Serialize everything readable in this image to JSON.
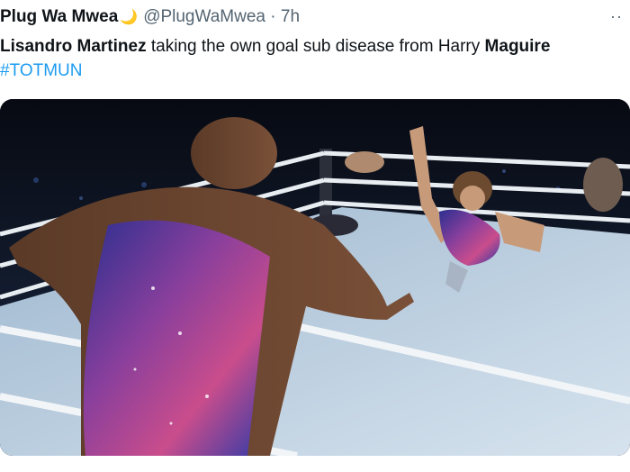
{
  "tweet": {
    "display_name": "Plug Wa Mwea",
    "name_emoji": "crescent-moon-icon",
    "handle": "@PlugWaMwea",
    "separator": "·",
    "time": "7h",
    "more_label": "··",
    "text": {
      "part1_bold": "Lisandro Martinez",
      "part2": " taking the own goal sub disease from Harry ",
      "part3_bold": "Maguire",
      "hashtag": "#TOTMUN"
    },
    "media": {
      "name": "wrestling-ring-photo"
    }
  },
  "colors": {
    "text": "#0f1419",
    "secondary": "#536471",
    "link": "#1d9bf0",
    "moon": "#f4c430"
  }
}
